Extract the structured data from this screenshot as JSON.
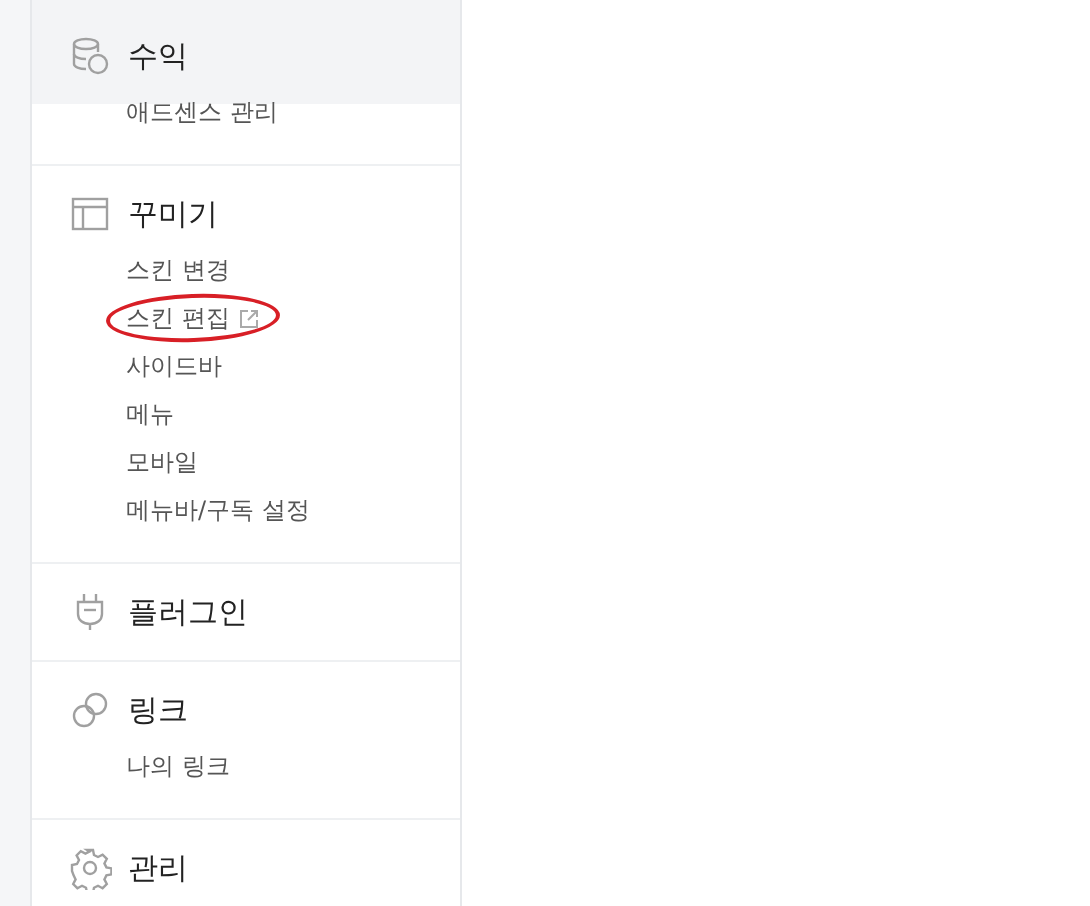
{
  "sidebar": {
    "sections": [
      {
        "label": "수익",
        "highlighted": true,
        "items": [
          {
            "label": "애드센스 관리",
            "external": false,
            "circled": false
          }
        ]
      },
      {
        "label": "꾸미기",
        "highlighted": false,
        "items": [
          {
            "label": "스킨 변경",
            "external": false,
            "circled": false
          },
          {
            "label": "스킨 편집",
            "external": true,
            "circled": true
          },
          {
            "label": "사이드바",
            "external": false,
            "circled": false
          },
          {
            "label": "메뉴",
            "external": false,
            "circled": false
          },
          {
            "label": "모바일",
            "external": false,
            "circled": false
          },
          {
            "label": "메뉴바/구독 설정",
            "external": false,
            "circled": false
          }
        ]
      },
      {
        "label": "플러그인",
        "highlighted": false
      },
      {
        "label": "링크",
        "highlighted": false,
        "items": [
          {
            "label": "나의 링크",
            "external": false,
            "circled": false
          }
        ]
      },
      {
        "label": "관리",
        "highlighted": false
      }
    ]
  }
}
